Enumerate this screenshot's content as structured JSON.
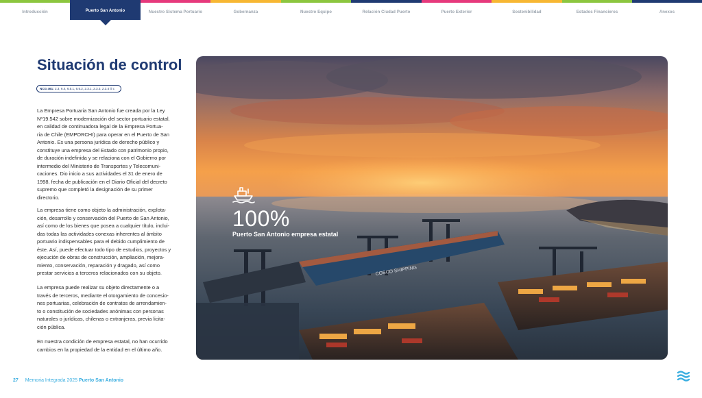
{
  "nav": {
    "tabs": [
      {
        "label": "Introducción",
        "color": "#8cc63f"
      },
      {
        "label": "Puerto San Antonio",
        "color": "#1f3a72",
        "active": true
      },
      {
        "label": "Nuestro Sistema Portuario",
        "color": "#e6397c"
      },
      {
        "label": "Gobernanza",
        "color": "#f7b733"
      },
      {
        "label": "Nuestro Equipo",
        "color": "#8cc63f"
      },
      {
        "label": "Relación Ciudad Puerto",
        "color": "#1f3a72"
      },
      {
        "label": "Puerto Exterior",
        "color": "#e6397c"
      },
      {
        "label": "Sostenibilidad",
        "color": "#f7b733"
      },
      {
        "label": "Estados Financieros",
        "color": "#8cc63f"
      },
      {
        "label": "Anexos",
        "color": "#1f3a72"
      }
    ]
  },
  "page": {
    "title": "Situación de control",
    "ncg_label": "NCG 461:",
    "ncg_codes": "2.3, 6.4, 6.5.1, 6.5.2, 2.3.1, 2.3.3, 2.3.4 iii c"
  },
  "paragraphs": [
    [
      "La Empresa Portuaria San Antonio fue creada por la Ley",
      "Nº19.542 sobre modernización del sector portuario estatal,",
      "en calidad de continuadora legal de la Empresa Portua-",
      "ria de Chile (EMPORCHI) para operar en el Puerto de San",
      "Antonio. Es una persona jurídica de derecho público y",
      "constituye una empresa del Estado con patrimonio propio,",
      "de duración indefinida y se relaciona con el Gobierno por",
      "intermedio del Ministerio de Transportes y Telecomuni-",
      "caciones.  Dio inicio a sus actividades el 31 de enero de",
      "1998, fecha de publicación en el Diario Oficial del decreto",
      "supremo que completó la designación de su primer",
      "directorio."
    ],
    [
      "La empresa tiene como objeto la administración, explota-",
      "ción, desarrollo y conservación del Puerto de San Antonio,",
      "así como de los bienes que posea a cualquier título, inclui-",
      "das todas las actividades conexas inherentes al ámbito",
      "portuario indispensables para el debido cumplimiento de",
      "éste. Así, puede efectuar todo tipo de estudios, proyectos y",
      "ejecución de obras de construcción, ampliación, mejora-",
      "miento, conservación, reparación y dragado, así como",
      "prestar servicios a terceros relacionados con su objeto."
    ],
    [
      "La empresa puede realizar su objeto directamente o a",
      "través de terceros, mediante el otorgamiento de concesio-",
      "nes portuarias, celebración de contratos de arrendamien-",
      "to o constitución de sociedades anónimas con personas",
      "naturales o jurídicas, chilenas o extranjeras, previa licita-",
      "ción pública."
    ],
    [
      "En nuestra condición de empresa estatal, no han ocurrido",
      "cambios en la propiedad de la entidad en el último año."
    ]
  ],
  "photo": {
    "stat_value": "100%",
    "stat_label": "Puerto San Antonio empresa estatal",
    "stat_icon": "ship-icon",
    "ship_text": "COSCO SHIPPING"
  },
  "footer": {
    "page_number": "27",
    "report": "Memoria Integrada 2025",
    "port": "Puerto San Antonio",
    "logo_icon": "waves-logo-icon"
  }
}
